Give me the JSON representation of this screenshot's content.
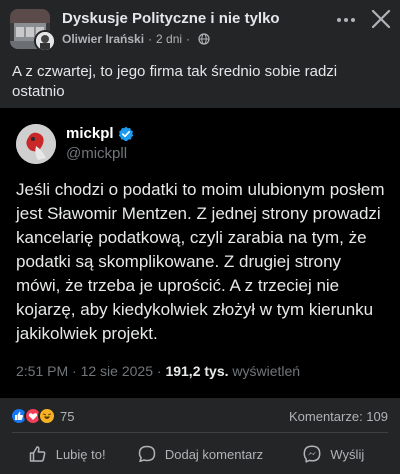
{
  "header": {
    "group_name": "Dyskusje Polityczne i nie tylko",
    "author": "Oliwier Irański",
    "separator": "·",
    "time": "2 dni",
    "separator2": "·"
  },
  "post": {
    "text": "A z czwartej, to jego firma tak średnio sobie radzi ostatnio"
  },
  "tweet": {
    "name": "mickpl",
    "handle": "@mickpll",
    "text": "Jeśli chodzi o podatki to moim ulubionym posłem jest Sławomir Mentzen. Z jednej strony prowadzi kancelarię podatkową, czyli zarabia na tym, że podatki są skomplikowane. Z drugiej strony mówi, że trzeba je uprościć. A z trzeciej nie kojarzę, aby kiedykolwiek złożył w tym kierunku jakikolwiek projekt.",
    "time": "2:51 PM",
    "dot1": "·",
    "date": "12 sie 2025",
    "dot2": "·",
    "views": "191,2 tys.",
    "views_label": "wyświetleń"
  },
  "stats": {
    "reactions_count": "75",
    "comments": "Komentarze: 109"
  },
  "actions": {
    "like": "Lubię to!",
    "comment": "Dodaj komentarz",
    "send": "Wyślij"
  },
  "colors": {
    "background": "#242526",
    "tweet_bg": "#000000",
    "verified": "#1d9bf0",
    "like": "#1877f2",
    "love": "#f33e58",
    "haha": "#f7b125"
  }
}
